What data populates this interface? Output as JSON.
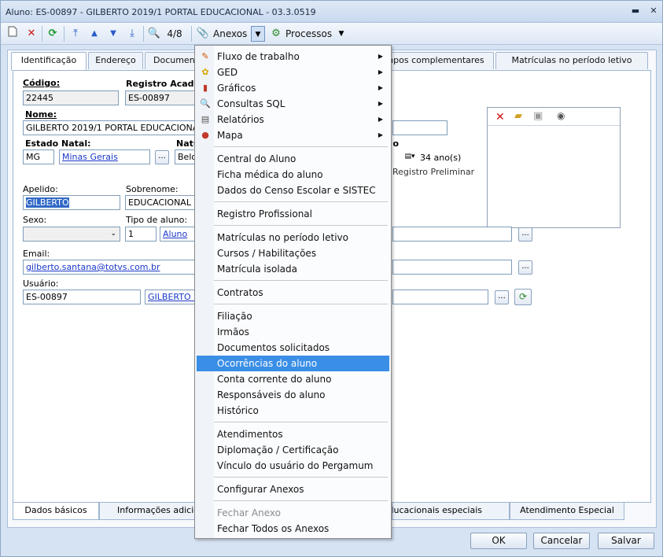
{
  "window": {
    "title": "Aluno: ES-00897 - GILBERTO 2019/1 PORTAL EDUCACIONAL - 03.3.0519",
    "min_glyph": "▬",
    "close_glyph": "✕"
  },
  "toolbar": {
    "record_position": "4/8",
    "anexos_label": "Anexos",
    "processos_label": "Processos"
  },
  "tabs_top": [
    "Identificação",
    "Endereço",
    "Documentos",
    "Campos complementares",
    "Matrículas no período letivo"
  ],
  "tabs_bottom": [
    "Dados básicos",
    "Informações adicionais",
    "Necessidades educacionais especiais",
    "Atendimento Especial"
  ],
  "form": {
    "codigo_label": "Código:",
    "codigo_value": "22445",
    "registro_label": "Registro Acadêmico:",
    "registro_value": "ES-00897",
    "nome_label": "Nome:",
    "nome_value": "GILBERTO 2019/1 PORTAL EDUCACIONAL",
    "estado_natal_label": "Estado Natal:",
    "estado_natal_value": "MG",
    "estado_natal_link": "Minas Gerais",
    "naturalidade_label": "Naturalidade:",
    "naturalidade_value": "Belo Horizonte",
    "nascimento_label": "Data de nascimento:",
    "idade_value": "34 ano(s)",
    "registro_preliminar": "Registro Preliminar",
    "apelido_label": "Apelido:",
    "apelido_value": "GILBERTO",
    "sobrenome_label": "Sobrenome:",
    "sobrenome_value": "EDUCACIONAL",
    "sexo_label": "Sexo:",
    "tipo_aluno_label": "Tipo de aluno:",
    "tipo_aluno_code": "1",
    "tipo_aluno_link": "Aluno",
    "email_label": "Email:",
    "email_value": "gilberto.santana@totvs.com.br",
    "usuario_label": "Usuário:",
    "usuario_value": "ES-00897",
    "usuario_link": "GILBERTO 2019/1 PORTAL EDUCACIONAL"
  },
  "buttons": {
    "ok": "OK",
    "cancelar": "Cancelar",
    "salvar": "Salvar",
    "ellipsis": "..."
  },
  "menu": {
    "submenus": [
      {
        "label": "Fluxo de trabalho",
        "icon": "workflow-icon"
      },
      {
        "label": "GED",
        "icon": "ged-icon"
      },
      {
        "label": "Gráficos",
        "icon": "chart-icon"
      },
      {
        "label": "Consultas SQL",
        "icon": "sql-icon"
      },
      {
        "label": "Relatórios",
        "icon": "report-icon"
      },
      {
        "label": "Mapa",
        "icon": "map-pin-icon"
      }
    ],
    "group1": [
      "Central do Aluno",
      "Ficha médica do aluno",
      "Dados do Censo Escolar e SISTEC"
    ],
    "group2": [
      "Registro Profissional"
    ],
    "group3": [
      "Matrículas no período letivo",
      "Cursos / Habilitações",
      "Matrícula isolada"
    ],
    "group4": [
      "Contratos"
    ],
    "group5": [
      "Filiação",
      "Irmãos",
      "Documentos solicitados",
      "Ocorrências do aluno",
      "Conta corrente do aluno",
      "Responsáveis do aluno",
      "Histórico"
    ],
    "group6": [
      "Atendimentos",
      "Diplomação / Certificação",
      "Vínculo do usuário do Pergamum"
    ],
    "group7": [
      "Configurar Anexos"
    ],
    "group8": [
      "Fechar Anexo",
      "Fechar Todos os Anexos"
    ],
    "highlighted": "Ocorrências do aluno",
    "disabled": "Fechar Anexo"
  },
  "colors": {
    "accent": "#3a8ee6",
    "link": "#1a37c8",
    "selection": "#3169c6"
  }
}
